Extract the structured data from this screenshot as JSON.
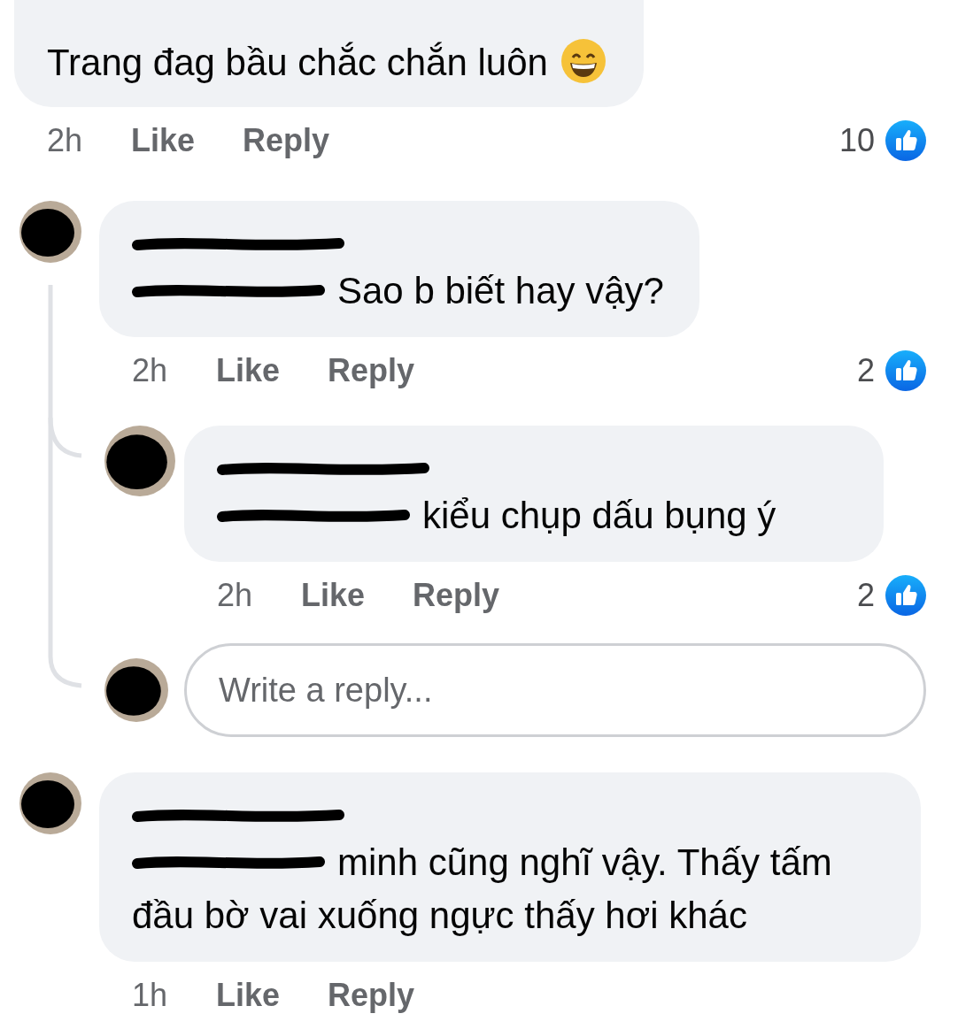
{
  "top_comment": {
    "text": "Trang đag bầu chắc chắn luôn",
    "time": "2h",
    "like": "Like",
    "reply": "Reply",
    "reactions": "10"
  },
  "comments": [
    {
      "mention": true,
      "lines": [
        "Sao b biết hay vậy?"
      ],
      "time": "2h",
      "like": "Like",
      "reply": "Reply",
      "reactions": "2",
      "children": [
        {
          "mention": true,
          "lines": [
            "kiểu chụp dấu bụng ý"
          ],
          "time": "2h",
          "like": "Like",
          "reply": "Reply",
          "reactions": "2"
        }
      ],
      "reply_box": {
        "placeholder": "Write a reply..."
      }
    },
    {
      "mention": true,
      "lines": [
        "minh cũng nghĩ vậy. Thấy tấm",
        "đầu bờ vai xuống ngực thấy hơi khác"
      ],
      "time": "1h",
      "like": "Like",
      "reply": "Reply"
    }
  ]
}
